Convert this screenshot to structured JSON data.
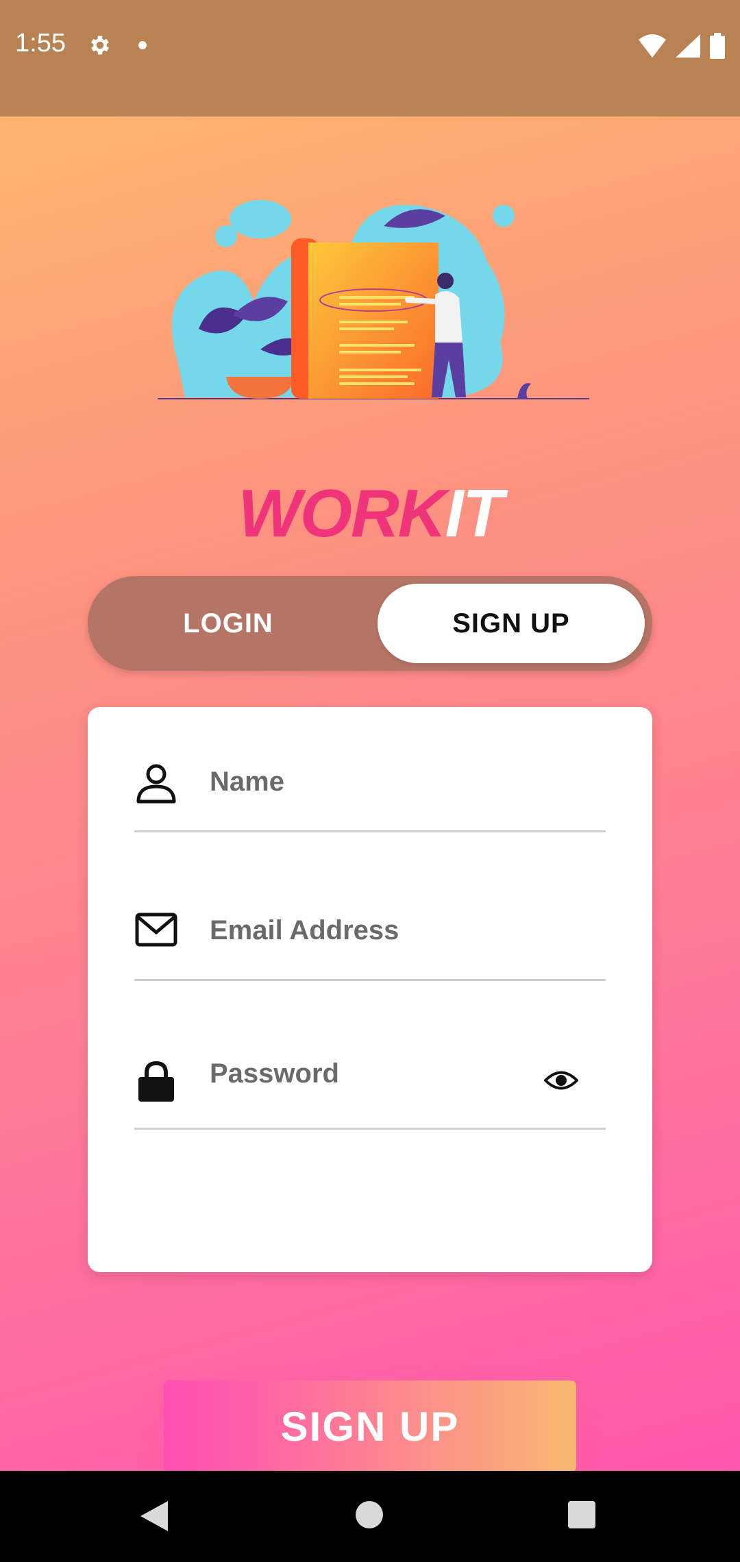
{
  "status_bar": {
    "time": "1:55",
    "icons": [
      "gear-icon",
      "notification-dot-icon",
      "wifi-icon",
      "cell-signal-icon",
      "battery-icon"
    ]
  },
  "app": {
    "logo": {
      "part1": "WORK",
      "part2": "IT"
    },
    "tabs": [
      {
        "label": "LOGIN",
        "selected": false
      },
      {
        "label": "SIGN UP",
        "selected": true
      }
    ],
    "form": {
      "name": {
        "placeholder": "Name",
        "value": "",
        "icon": "person-icon"
      },
      "email": {
        "placeholder": "Email Address",
        "value": "",
        "icon": "envelope-icon"
      },
      "password": {
        "placeholder": "Password",
        "value": "",
        "icon": "lock-icon",
        "toggle_icon": "eye-icon"
      }
    },
    "submit_label": "SIGN UP"
  },
  "nav_bar": {
    "icons": [
      "back-icon",
      "home-icon",
      "recents-icon"
    ]
  },
  "colors": {
    "status_bar": "#b88252",
    "logo_accent": "#f0347a",
    "toggle_track": "#b47466",
    "button_start": "#ff4fb4",
    "button_end": "#f8b870"
  }
}
